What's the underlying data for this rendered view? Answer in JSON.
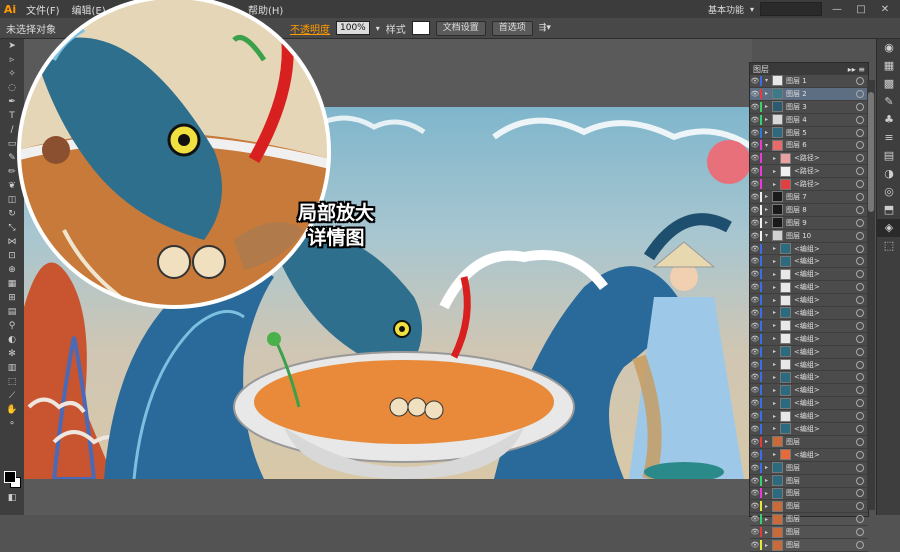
{
  "app": {
    "logo": "Ai",
    "workspace_label": "基本功能"
  },
  "menu": {
    "items": [
      "文件(F)",
      "编辑(E)",
      "帮助(H)"
    ]
  },
  "window_controls": {
    "minimize": "—",
    "maximize": "□",
    "close": "✕"
  },
  "control_bar": {
    "selection_status": "未选择对象",
    "opacity_label": "不透明度",
    "opacity_value": "100%",
    "style_label": "样式",
    "doc_setup_button": "文档设置",
    "preferences_button": "首选项"
  },
  "callout": {
    "line1": "局部放大",
    "line2": "详情图"
  },
  "colors": {
    "accent": "#ff9a00",
    "selection": "#5e6e82",
    "panel": "#4b4b4b"
  },
  "layers_panel": {
    "tab_label": "图层",
    "rows": [
      {
        "name": "图层 1",
        "color": "#3a6ee8",
        "thumb": "#e8e8e8",
        "expanded": true
      },
      {
        "name": "图层 2",
        "color": "#e83a3a",
        "thumb": "#3a7a8a",
        "selected": true
      },
      {
        "name": "图层 3",
        "color": "#3ad06e",
        "thumb": "#2c5a70"
      },
      {
        "name": "图层 4",
        "color": "#3ad06e",
        "thumb": "#d8d8d8"
      },
      {
        "name": "图层 5",
        "color": "#2a7ad8",
        "thumb": "#2d6a80"
      },
      {
        "name": "图层 6",
        "color": "#e83ad8",
        "thumb": "#e86a6a",
        "expanded": true
      },
      {
        "name": "<路径>",
        "color": "#e83ad8",
        "thumb": "#e8a0a0"
      },
      {
        "name": "<路径>",
        "color": "#e83ad8",
        "thumb": "#f0f0f0"
      },
      {
        "name": "<路径>",
        "color": "#e83ad8",
        "thumb": "#e04040"
      },
      {
        "name": "图层 7",
        "color": "#eeeeee",
        "thumb": "#1a1a1a"
      },
      {
        "name": "图层 8",
        "color": "#eeeeee",
        "thumb": "#1a1a1a"
      },
      {
        "name": "图层 9",
        "color": "#eeeeee",
        "thumb": "#1a1a1a"
      },
      {
        "name": "图层 10",
        "color": "#eeeeee",
        "thumb": "#d0d0d0",
        "expanded": true
      },
      {
        "name": "<编组>",
        "color": "#3a6ee8",
        "thumb": "#2c6a80"
      },
      {
        "name": "<编组>",
        "color": "#3a6ee8",
        "thumb": "#2c6a80"
      },
      {
        "name": "<编组>",
        "color": "#3a6ee8",
        "thumb": "#e8e8e8"
      },
      {
        "name": "<编组>",
        "color": "#3a6ee8",
        "thumb": "#e8e8e8"
      },
      {
        "name": "<编组>",
        "color": "#3a6ee8",
        "thumb": "#e8e8e8"
      },
      {
        "name": "<编组>",
        "color": "#3a6ee8",
        "thumb": "#2c6a80"
      },
      {
        "name": "<编组>",
        "color": "#3a6ee8",
        "thumb": "#e8e8e8"
      },
      {
        "name": "<编组>",
        "color": "#3a6ee8",
        "thumb": "#e8e8e8"
      },
      {
        "name": "<编组>",
        "color": "#3a6ee8",
        "thumb": "#2c6a80"
      },
      {
        "name": "<编组>",
        "color": "#3a6ee8",
        "thumb": "#e8e8e8"
      },
      {
        "name": "<编组>",
        "color": "#3a6ee8",
        "thumb": "#2c6a80"
      },
      {
        "name": "<编组>",
        "color": "#3a6ee8",
        "thumb": "#2c6a80"
      },
      {
        "name": "<编组>",
        "color": "#3a6ee8",
        "thumb": "#2c6a80"
      },
      {
        "name": "<编组>",
        "color": "#3a6ee8",
        "thumb": "#e8e8e8"
      },
      {
        "name": "<编组>",
        "color": "#3a6ee8",
        "thumb": "#2c6a80"
      },
      {
        "name": "图层",
        "color": "#e83a3a",
        "thumb": "#c86a3a"
      },
      {
        "name": "<编组>",
        "color": "#3a6ee8",
        "thumb": "#e86a3a"
      },
      {
        "name": "图层",
        "color": "#3a6ee8",
        "thumb": "#2c6a80"
      },
      {
        "name": "图层",
        "color": "#3ad06e",
        "thumb": "#2c6a80"
      },
      {
        "name": "图层",
        "color": "#e83ad8",
        "thumb": "#2c6a80"
      },
      {
        "name": "图层",
        "color": "#e8e83a",
        "thumb": "#c86a3a"
      },
      {
        "name": "图层",
        "color": "#3ad06e",
        "thumb": "#c86a3a"
      },
      {
        "name": "图层",
        "color": "#e83a3a",
        "thumb": "#c86a3a"
      },
      {
        "name": "图层",
        "color": "#e8e83a",
        "thumb": "#c86a3a"
      }
    ]
  }
}
